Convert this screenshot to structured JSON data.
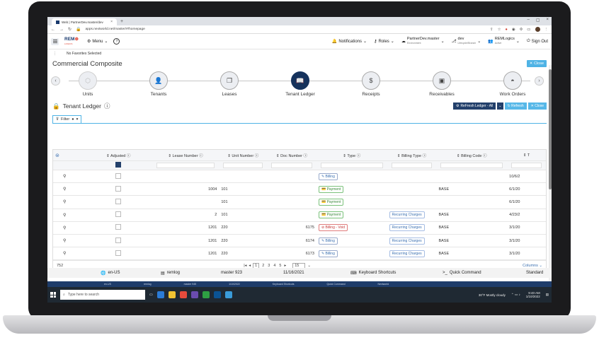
{
  "browser": {
    "tab_title": "Web | PartnerDev.master/dev",
    "url": "apps.nextworld.net/master/#/homepage"
  },
  "header": {
    "logo_text_1": "REM",
    "logo_text_2": "LOGICS",
    "menu_label": "Menu",
    "notifications_label": "Notifications",
    "roles_label": "Roles",
    "env_name": "PartnerDev.master",
    "env_sub": "Environment",
    "lifecycle_name": "dev",
    "lifecycle_sub": "Lifecycle/Branch",
    "user_name": "REMLogics",
    "user_sub": "Active",
    "signout_label": "Sign Out"
  },
  "favorites": {
    "dots": "⋮",
    "text": "No Favorites Selected"
  },
  "page": {
    "title": "Commercial Composite",
    "close_label": "Close"
  },
  "steps": [
    {
      "label": "Units"
    },
    {
      "label": "Tenants"
    },
    {
      "label": "Leases"
    },
    {
      "label": "Tenant Ledger"
    },
    {
      "label": "Receipts"
    },
    {
      "label": "Receivables"
    },
    {
      "label": "Work Orders"
    }
  ],
  "section": {
    "title": "Tenant Ledger",
    "refresh_all_label": "ReFresh Ledger - All",
    "refresh_label": "Refresh",
    "close_label": "Close"
  },
  "filter": {
    "label": "Filter"
  },
  "grid": {
    "columns": [
      "Adjusted",
      "Lease Number",
      "Unit Number",
      "Doc Number",
      "Type",
      "Billing Type",
      "Billing Code",
      "T"
    ],
    "rows": [
      {
        "lease": "",
        "unit": "",
        "doc": "",
        "type": "Billing",
        "type_kind": "bill",
        "billing_type": "",
        "billing_code": "",
        "date": "10/6/2"
      },
      {
        "lease": "1004",
        "unit": "101",
        "doc": "",
        "type": "Payment",
        "type_kind": "pay",
        "billing_type": "",
        "billing_code": "BASE",
        "date": "6/1/20"
      },
      {
        "lease": "",
        "unit": "101",
        "doc": "",
        "type": "Payment",
        "type_kind": "pay",
        "billing_type": "",
        "billing_code": "",
        "date": "6/1/20"
      },
      {
        "lease": "2",
        "unit": "101",
        "doc": "",
        "type": "Payment",
        "type_kind": "pay",
        "billing_type": "Recurring Charges",
        "billing_code": "BASE",
        "date": "4/23/2"
      },
      {
        "lease": "1201",
        "unit": "220",
        "doc": "6175",
        "type": "Billing - Void",
        "type_kind": "void",
        "billing_type": "Recurring Charges",
        "billing_code": "BASE",
        "date": "3/1/20"
      },
      {
        "lease": "1201",
        "unit": "220",
        "doc": "6174",
        "type": "Billing",
        "type_kind": "bill",
        "billing_type": "Recurring Charges",
        "billing_code": "BASE",
        "date": "3/1/20"
      },
      {
        "lease": "1201",
        "unit": "220",
        "doc": "6173",
        "type": "Billing",
        "type_kind": "bill",
        "billing_type": "Recurring Charges",
        "billing_code": "BASE",
        "date": "3/1/20"
      }
    ],
    "total": "752",
    "pages": [
      "1",
      "2",
      "3",
      "4",
      "5"
    ],
    "page_size": "15",
    "columns_label": "Columns"
  },
  "statusbar": {
    "locale": "en-US",
    "user": "remlog",
    "version": "master 923",
    "date": "11/16/2021",
    "shortcuts": "Keyboard Shortcuts",
    "quick_command": "Quick Command",
    "mode": "Standard"
  },
  "taskbar": {
    "search_placeholder": "Type here to search",
    "weather": "30°F  Mostly cloudy",
    "time": "9:40 AM",
    "date": "1/10/2022"
  },
  "taskstrip": {
    "items": [
      "en-US",
      "remlog",
      "master 945",
      "1/10/2022",
      "Keyboard Shortcuts",
      "Quick Command",
      "Nextworld"
    ]
  }
}
